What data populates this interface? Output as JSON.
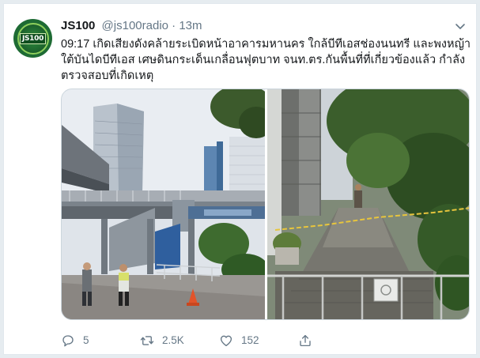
{
  "tweet": {
    "display_name": "JS100",
    "handle": "@js100radio",
    "separator": "·",
    "time": "13m",
    "text": "09:17 เกิดเสียงดังคล้ายระเบิดหน้าอาคารมหานคร ใกล้บีทีเอสช่องนนทรี และพงหญ้าใต้บันไดบีทีเอส เศษดินกระเด็นเกลื่อนฟุตบาท จนท.ตร.กันพื้นที่ที่เกี่ยวข้องแล้ว กำลังตรวจสอบที่เกิดเหตุ",
    "avatar_logo_text": "JS100",
    "actions": {
      "reply_count": "5",
      "retweet_count": "2.5K",
      "like_count": "152",
      "share_count": ""
    }
  },
  "icons": {
    "avatar": "js100-logo-icon",
    "menu": "chevron-down-icon",
    "reply": "reply-icon",
    "retweet": "retweet-icon",
    "like": "heart-icon",
    "share": "share-icon"
  },
  "colors": {
    "background": "#e6ecf0",
    "card": "#ffffff",
    "text_primary": "#14171a",
    "text_secondary": "#657786",
    "border": "#e1e8ed",
    "avatar_green": "#1e6b34"
  }
}
